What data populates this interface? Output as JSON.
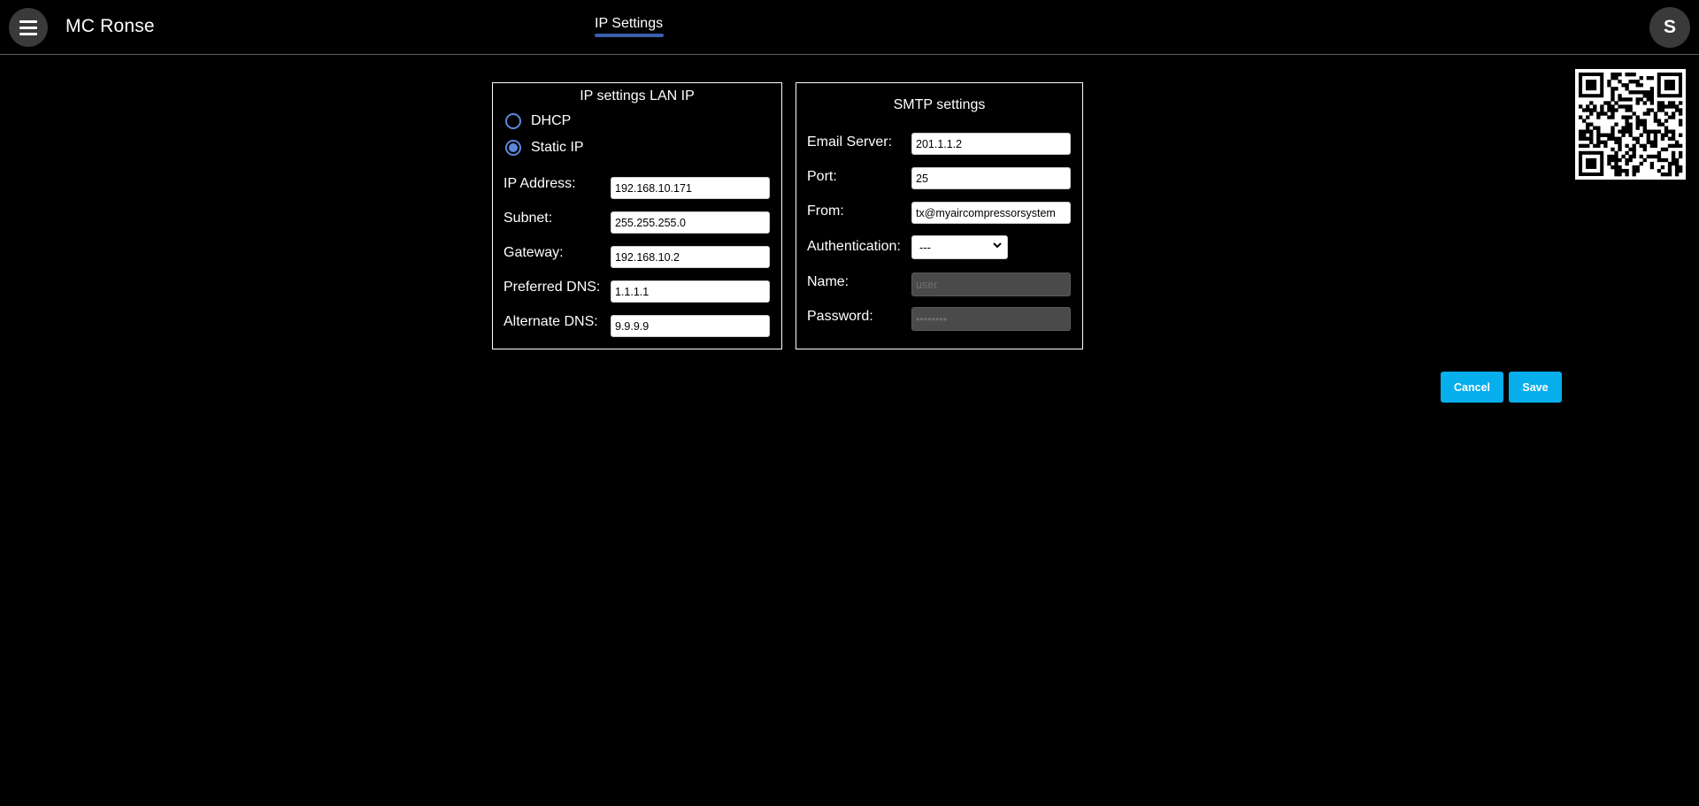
{
  "header": {
    "menu_icon": "hamburger-menu-icon",
    "app_title": "MC Ronse",
    "active_tab": "IP Settings",
    "avatar_initial": "S",
    "tab_underline_color": "#3b5fab"
  },
  "ip_panel": {
    "title": "IP settings LAN IP",
    "mode_options": [
      {
        "label": "DHCP",
        "checked": false
      },
      {
        "label": "Static IP",
        "checked": true
      }
    ],
    "fields": [
      {
        "label": "IP Address:",
        "value": "192.168.10.171"
      },
      {
        "label": "Subnet:",
        "value": "255.255.255.0"
      },
      {
        "label": "Gateway:",
        "value": "192.168.10.2"
      },
      {
        "label": "Preferred DNS:",
        "value": "1.1.1.1"
      },
      {
        "label": "Alternate DNS:",
        "value": "9.9.9.9"
      }
    ]
  },
  "smtp_panel": {
    "title": "SMTP settings",
    "email_server": {
      "label": "Email Server:",
      "value": "201.1.1.2"
    },
    "port": {
      "label": "Port:",
      "value": "25"
    },
    "from": {
      "label": "From:",
      "value": "tx@myaircompressorsystem"
    },
    "authentication": {
      "label": "Authentication:",
      "selected": "---"
    },
    "name": {
      "label": "Name:",
      "placeholder": "user",
      "disabled": true
    },
    "password": {
      "label": "Password:",
      "placeholder": "••••••••",
      "disabled": true
    }
  },
  "actions": {
    "cancel_label": "Cancel",
    "save_label": "Save",
    "button_color": "#06aeec"
  },
  "qr_code": {
    "icon": "qr-code-icon"
  }
}
